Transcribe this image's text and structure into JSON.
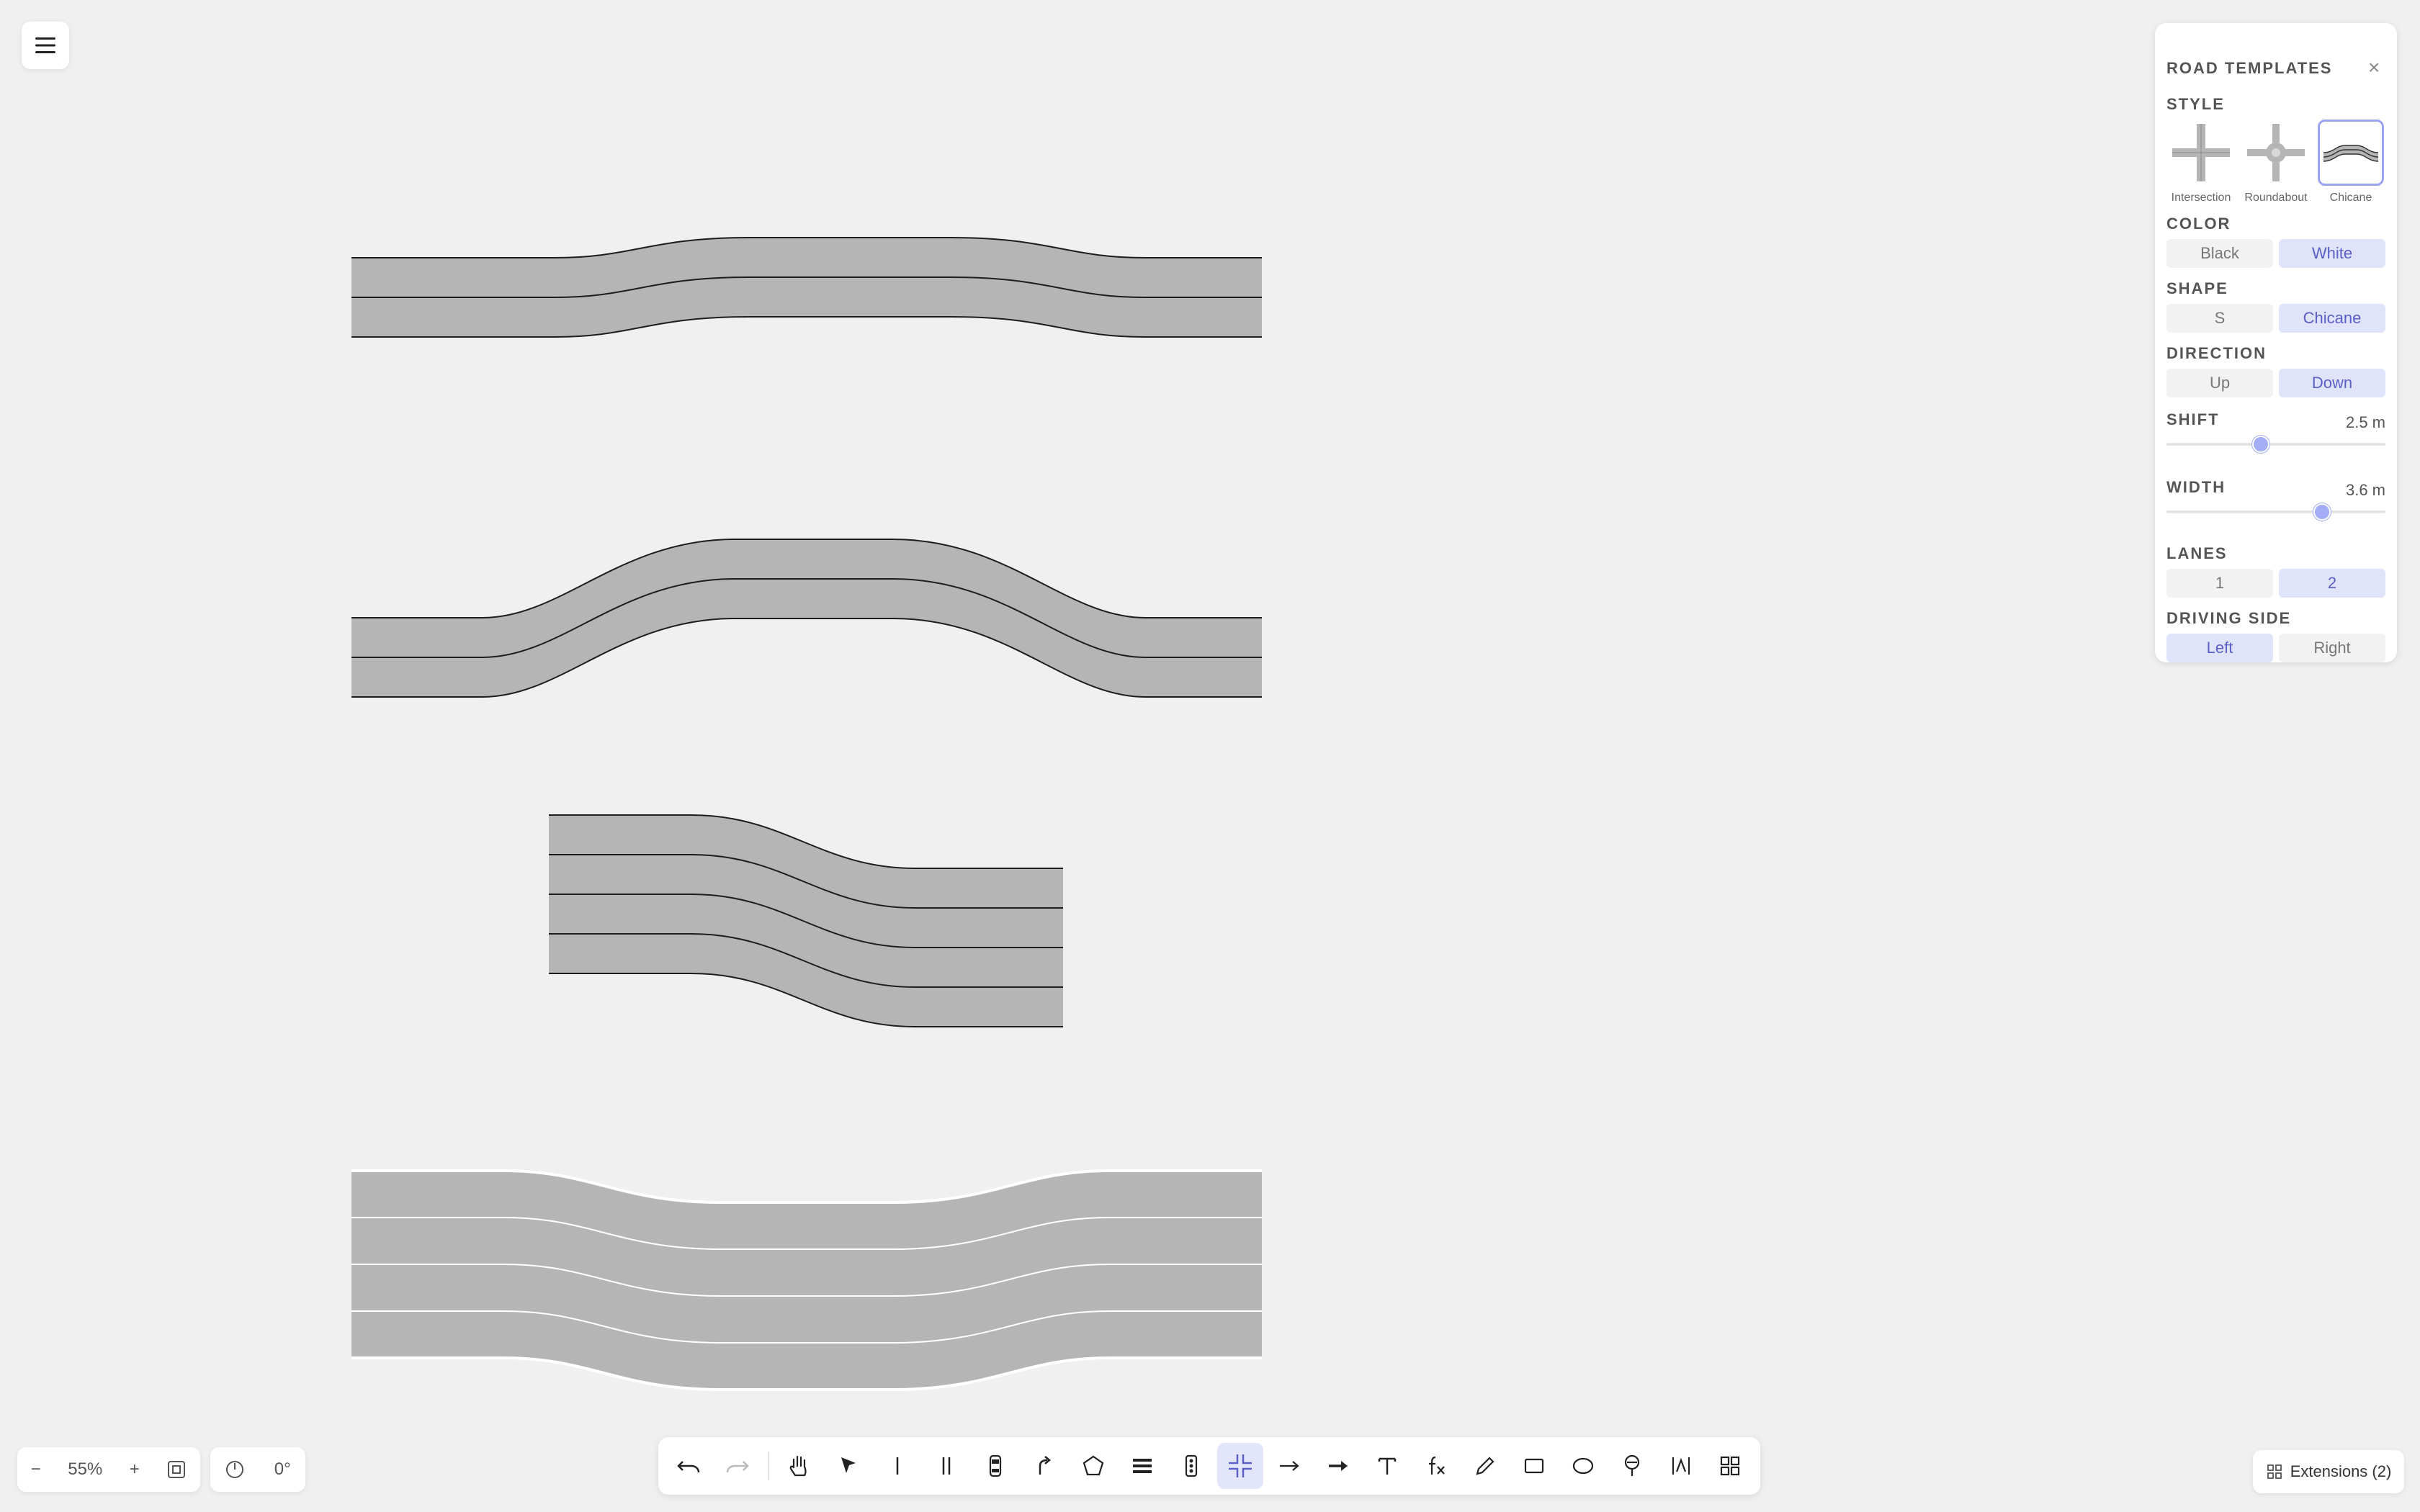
{
  "canvas": {
    "roads": [
      {
        "name": "road-chicane-up-white",
        "lane_count": 2,
        "lane_line_color": "#222222"
      },
      {
        "name": "road-chicane-up-large",
        "lane_count": 2,
        "lane_line_color": "#222222"
      },
      {
        "name": "road-s-curve-down",
        "lane_count": 4,
        "lane_line_color": "#222222"
      },
      {
        "name": "road-chicane-down-wide",
        "lane_count": 4,
        "lane_line_color": "#ffffff"
      }
    ],
    "road_fill_color": "#b5b5b5"
  },
  "panel": {
    "title": "ROAD TEMPLATES",
    "close_glyph": "×",
    "style": {
      "label": "STYLE",
      "options": [
        {
          "label": "Intersection",
          "icon": "intersection-icon"
        },
        {
          "label": "Roundabout",
          "icon": "roundabout-icon"
        },
        {
          "label": "Chicane",
          "icon": "chicane-icon"
        }
      ],
      "selected": "Chicane"
    },
    "color": {
      "label": "COLOR",
      "options": [
        "Black",
        "White"
      ],
      "selected": "White"
    },
    "shape": {
      "label": "SHAPE",
      "options": [
        "S",
        "Chicane"
      ],
      "selected": "Chicane"
    },
    "direction": {
      "label": "DIRECTION",
      "options": [
        "Up",
        "Down"
      ],
      "selected": "Down"
    },
    "shift": {
      "label": "SHIFT",
      "value_text": "2.5 m",
      "fraction": 0.43
    },
    "width": {
      "label": "WIDTH",
      "value_text": "3.6 m",
      "fraction": 0.71
    },
    "lanes": {
      "label": "LANES",
      "options": [
        "1",
        "2"
      ],
      "selected": "2"
    },
    "driving_side": {
      "label": "DRIVING SIDE",
      "options": [
        "Left",
        "Right"
      ],
      "selected": "Left"
    }
  },
  "zoom": {
    "minus": "−",
    "level": "55%",
    "plus": "+"
  },
  "rotation": {
    "value": "0°"
  },
  "toolbar": {
    "tools": [
      {
        "name": "undo-icon"
      },
      {
        "name": "redo-icon"
      },
      {
        "name": "hand-tool-icon"
      },
      {
        "name": "select-arrow-icon"
      },
      {
        "name": "single-line-icon"
      },
      {
        "name": "double-line-icon"
      },
      {
        "name": "car-icon"
      },
      {
        "name": "curved-path-icon"
      },
      {
        "name": "polygon-icon"
      },
      {
        "name": "lanes-icon"
      },
      {
        "name": "traffic-light-icon"
      },
      {
        "name": "road-template-icon"
      },
      {
        "name": "arrow-thin-icon"
      },
      {
        "name": "arrow-bold-icon"
      },
      {
        "name": "text-icon"
      },
      {
        "name": "function-icon"
      },
      {
        "name": "pencil-icon"
      },
      {
        "name": "rectangle-icon"
      },
      {
        "name": "ellipse-icon"
      },
      {
        "name": "sign-icon"
      },
      {
        "name": "measure-icon"
      },
      {
        "name": "grid-apps-icon"
      }
    ],
    "active": "road-template-icon",
    "disabled": [
      "redo-icon"
    ]
  },
  "extensions": {
    "label": "Extensions (2)"
  },
  "colors": {
    "accent": "#5a5fc6",
    "accent_bg": "#e0e4fb",
    "canvas_bg": "#f0f0f0"
  }
}
